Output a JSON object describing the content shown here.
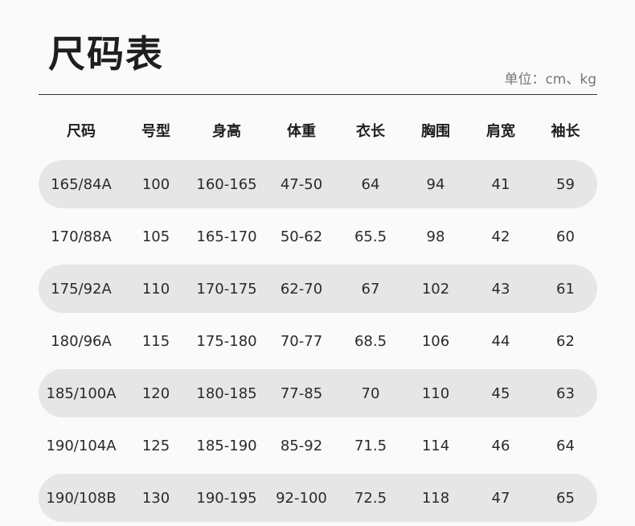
{
  "title": "尺码表",
  "unit_label": "单位：cm、kg",
  "table": {
    "headers": [
      "尺码",
      "号型",
      "身高",
      "体重",
      "衣长",
      "胸围",
      "肩宽",
      "袖长"
    ],
    "rows": [
      [
        "165/84A",
        "100",
        "160-165",
        "47-50",
        "64",
        "94",
        "41",
        "59"
      ],
      [
        "170/88A",
        "105",
        "165-170",
        "50-62",
        "65.5",
        "98",
        "42",
        "60"
      ],
      [
        "175/92A",
        "110",
        "170-175",
        "62-70",
        "67",
        "102",
        "43",
        "61"
      ],
      [
        "180/96A",
        "115",
        "175-180",
        "70-77",
        "68.5",
        "106",
        "44",
        "62"
      ],
      [
        "185/100A",
        "120",
        "180-185",
        "77-85",
        "70",
        "110",
        "45",
        "63"
      ],
      [
        "190/104A",
        "125",
        "185-190",
        "85-92",
        "71.5",
        "114",
        "46",
        "64"
      ],
      [
        "190/108B",
        "130",
        "190-195",
        "92-100",
        "72.5",
        "118",
        "47",
        "65"
      ]
    ]
  }
}
